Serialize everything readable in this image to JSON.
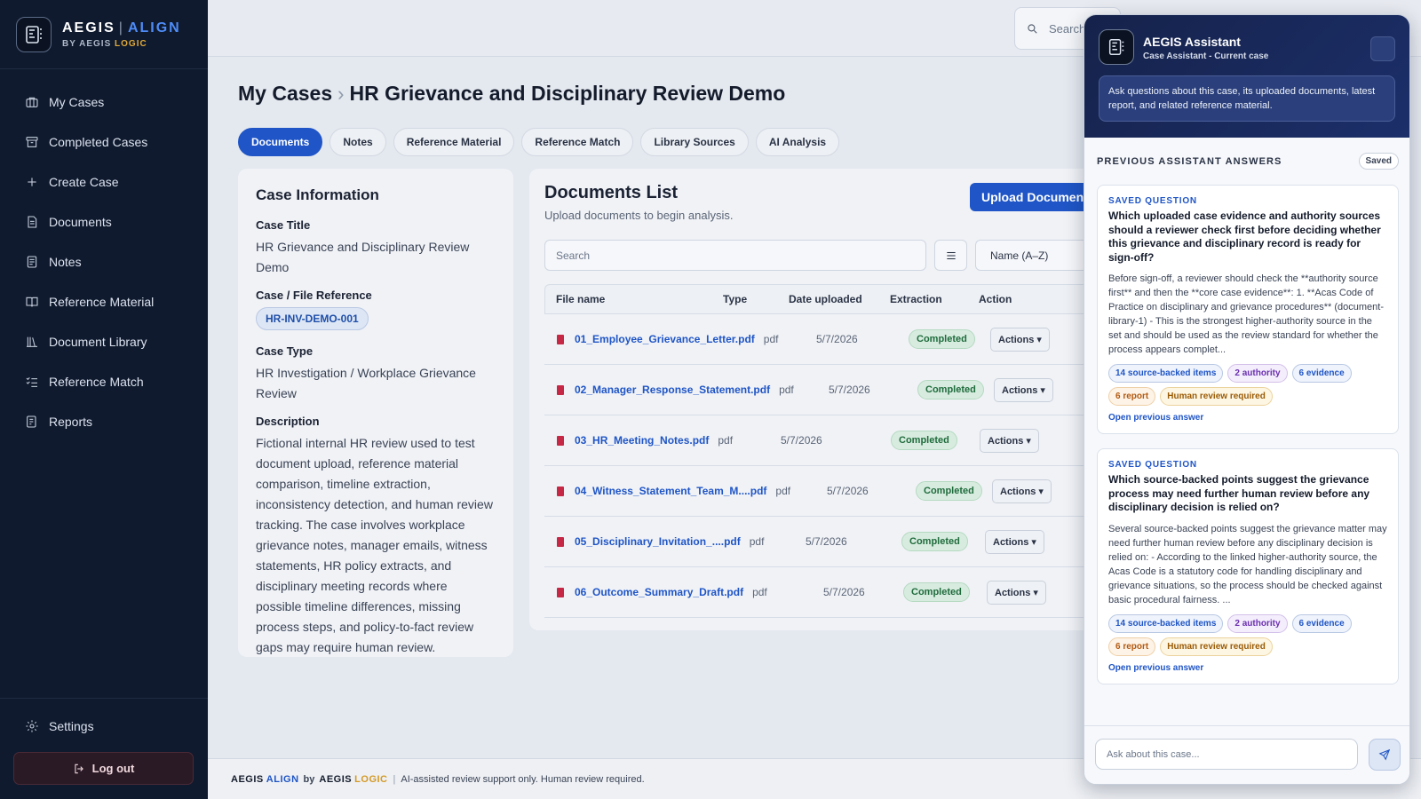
{
  "brand": {
    "name": "AEGIS",
    "product": "ALIGN",
    "by": "BY AEGIS",
    "logic": "LOGIC"
  },
  "nav": {
    "items": [
      {
        "label": "My Cases",
        "icon": "briefcase-icon"
      },
      {
        "label": "Completed Cases",
        "icon": "archive-icon"
      },
      {
        "label": "Create Case",
        "icon": "plus-icon"
      },
      {
        "label": "Documents",
        "icon": "document-icon"
      },
      {
        "label": "Notes",
        "icon": "notes-icon"
      },
      {
        "label": "Reference Material",
        "icon": "book-open-icon"
      },
      {
        "label": "Document Library",
        "icon": "library-icon"
      },
      {
        "label": "Reference Match",
        "icon": "checklist-icon"
      },
      {
        "label": "Reports",
        "icon": "report-icon"
      }
    ],
    "settings": "Settings",
    "logout": "Log out"
  },
  "topbar": {
    "search_placeholder": "Search"
  },
  "breadcrumb": {
    "root": "My Cases",
    "current": "HR Grievance and Disciplinary Review Demo"
  },
  "tabs": [
    "Documents",
    "Notes",
    "Reference Material",
    "Reference Match",
    "Library Sources",
    "AI Analysis"
  ],
  "case_info": {
    "title": "Case Information",
    "case_title_label": "Case Title",
    "case_title": "HR Grievance and Disciplinary Review Demo",
    "ref_label": "Case / File Reference",
    "ref": "HR-INV-DEMO-001",
    "type_label": "Case Type",
    "type": "HR Investigation / Workplace Grievance Review",
    "desc_label": "Description",
    "desc": "Fictional internal HR review used to test document upload, reference material comparison, timeline extraction, inconsistency detection, and human review tracking. The case involves workplace grievance notes, manager emails, witness statements, HR policy extracts, and disciplinary meeting records where possible timeline differences, missing process steps, and policy-to-fact review gaps may require human review."
  },
  "docs": {
    "title": "Documents List",
    "subtitle": "Upload documents to begin analysis.",
    "upload": "Upload Document",
    "search_placeholder": "Search",
    "sort": "Name (A–Z)",
    "headers": {
      "name": "File name",
      "type": "Type",
      "date": "Date uploaded",
      "extraction": "Extraction",
      "action": "Action"
    },
    "rows": [
      {
        "name": "01_Employee_Grievance_Letter.pdf",
        "type": "pdf",
        "date": "5/7/2026",
        "status": "Completed",
        "action": "Actions ▾"
      },
      {
        "name": "02_Manager_Response_Statement.pdf",
        "type": "pdf",
        "date": "5/7/2026",
        "status": "Completed",
        "action": "Actions ▾"
      },
      {
        "name": "03_HR_Meeting_Notes.pdf",
        "type": "pdf",
        "date": "5/7/2026",
        "status": "Completed",
        "action": "Actions ▾"
      },
      {
        "name": "04_Witness_Statement_Team_M....pdf",
        "type": "pdf",
        "date": "5/7/2026",
        "status": "Completed",
        "action": "Actions ▾"
      },
      {
        "name": "05_Disciplinary_Invitation_....pdf",
        "type": "pdf",
        "date": "5/7/2026",
        "status": "Completed",
        "action": "Actions ▾"
      },
      {
        "name": "06_Outcome_Summary_Draft.pdf",
        "type": "pdf",
        "date": "5/7/2026",
        "status": "Completed",
        "action": "Actions ▾"
      }
    ]
  },
  "footer": {
    "a1": "AEGIS",
    "a2": "ALIGN",
    "by": "by",
    "b1": "AEGIS",
    "b2": "LOGIC",
    "sep": "|",
    "note": "AI-assisted review support only. Human review required."
  },
  "assistant": {
    "title": "AEGIS Assistant",
    "subtitle": "Case Assistant - Current case",
    "intro": "Ask questions about this case, its uploaded documents, latest report, and related reference material.",
    "prev_heading": "PREVIOUS ASSISTANT ANSWERS",
    "saved": "Saved",
    "input_placeholder": "Ask about this case...",
    "answers": [
      {
        "kicker": "SAVED QUESTION",
        "question": "Which uploaded case evidence and authority sources should a reviewer check first before deciding whether this grievance and disciplinary record is ready for sign-off?",
        "body": "Before sign-off, a reviewer should check the **authority source first** and then the **core case evidence**: 1. **Acas Code of Practice on disciplinary and grievance procedures** (document-library-1) - This is the strongest higher-authority source in the set and should be used as the review standard for whether the process appears complet...",
        "chips": [
          "14 source-backed items",
          "2 authority",
          "6 evidence",
          "6 report",
          "Human review required"
        ],
        "link": "Open previous answer"
      },
      {
        "kicker": "SAVED QUESTION",
        "question": "Which source-backed points suggest the grievance process may need further human review before any disciplinary decision is relied on?",
        "body": "Several source-backed points suggest the grievance matter may need further human review before any disciplinary decision is relied on: - According to the linked higher-authority source, the Acas Code is a statutory code for handling disciplinary and grievance situations, so the process should be checked against basic procedural fairness. ...",
        "chips": [
          "14 source-backed items",
          "2 authority",
          "6 evidence",
          "6 report",
          "Human review required"
        ],
        "link": "Open previous answer"
      }
    ]
  }
}
